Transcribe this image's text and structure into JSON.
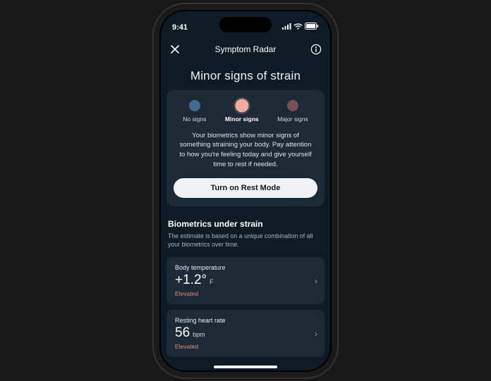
{
  "status": {
    "time": "9:41"
  },
  "nav": {
    "title": "Symptom Radar"
  },
  "page": {
    "title": "Minor signs of strain"
  },
  "levels": {
    "none": {
      "label": "No signs"
    },
    "minor": {
      "label": "Minor signs"
    },
    "major": {
      "label": "Major signs"
    }
  },
  "summary": {
    "description": "Your biometrics show minor signs of something straining your body. Pay attention to how you're feeling today and give yourself time to rest if needed.",
    "rest_button": "Turn on Rest Mode"
  },
  "biometrics": {
    "heading": "Biometrics under strain",
    "subheading": "The estimate is based on a unique combination of all your biometrics over time.",
    "items": [
      {
        "label": "Body temperature",
        "value": "+1.2°",
        "unit": "F",
        "status": "Elevated"
      },
      {
        "label": "Resting heart rate",
        "value": "56",
        "unit": "bpm",
        "status": "Elevated"
      }
    ]
  }
}
